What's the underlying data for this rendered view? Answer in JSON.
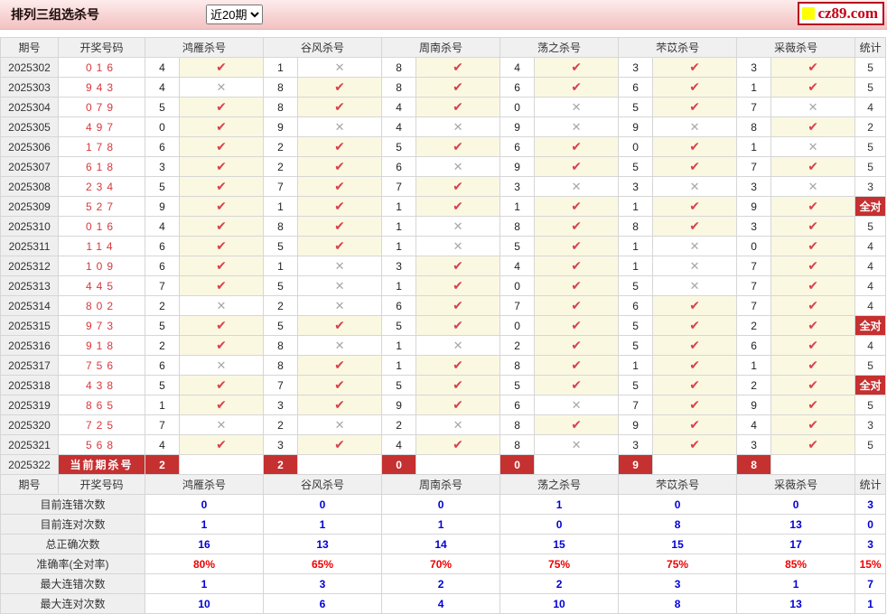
{
  "title_bar": {
    "title": "排列三组选杀号",
    "range_select": {
      "selected": "近20期"
    },
    "logo_text": "cz89.com"
  },
  "marks": {
    "check": "✔",
    "cross": "✕"
  },
  "colors": {
    "accent_red": "#c53030",
    "check_red": "#d8414d",
    "cross_gray": "#a7a7a7",
    "ok_cell_bg": "#fbf8e2",
    "value_blue": "#0000d6",
    "value_red": "#ee0000",
    "titlebar_pink": "#f6cdcd",
    "logo_yellow": "#ffff00"
  },
  "table": {
    "headers": {
      "period": "期号",
      "numbers": "开奖号码",
      "experts": [
        "鸿雁杀号",
        "谷风杀号",
        "周南杀号",
        "荡之杀号",
        "芣苡杀号",
        "采薇杀号"
      ],
      "stat": "统计"
    },
    "all_correct_label": "全对",
    "rows": [
      {
        "period": "2025302",
        "numbers": "016",
        "kills": [
          {
            "n": "4",
            "ok": true
          },
          {
            "n": "1",
            "ok": false
          },
          {
            "n": "8",
            "ok": true
          },
          {
            "n": "4",
            "ok": true
          },
          {
            "n": "3",
            "ok": true
          },
          {
            "n": "3",
            "ok": true
          }
        ],
        "stat": "5",
        "all_correct": false
      },
      {
        "period": "2025303",
        "numbers": "943",
        "kills": [
          {
            "n": "4",
            "ok": false
          },
          {
            "n": "8",
            "ok": true
          },
          {
            "n": "8",
            "ok": true
          },
          {
            "n": "6",
            "ok": true
          },
          {
            "n": "6",
            "ok": true
          },
          {
            "n": "1",
            "ok": true
          }
        ],
        "stat": "5",
        "all_correct": false
      },
      {
        "period": "2025304",
        "numbers": "079",
        "kills": [
          {
            "n": "5",
            "ok": true
          },
          {
            "n": "8",
            "ok": true
          },
          {
            "n": "4",
            "ok": true
          },
          {
            "n": "0",
            "ok": false
          },
          {
            "n": "5",
            "ok": true
          },
          {
            "n": "7",
            "ok": false
          }
        ],
        "stat": "4",
        "all_correct": false
      },
      {
        "period": "2025305",
        "numbers": "497",
        "kills": [
          {
            "n": "0",
            "ok": true
          },
          {
            "n": "9",
            "ok": false
          },
          {
            "n": "4",
            "ok": false
          },
          {
            "n": "9",
            "ok": false
          },
          {
            "n": "9",
            "ok": false
          },
          {
            "n": "8",
            "ok": true
          }
        ],
        "stat": "2",
        "all_correct": false
      },
      {
        "period": "2025306",
        "numbers": "178",
        "kills": [
          {
            "n": "6",
            "ok": true
          },
          {
            "n": "2",
            "ok": true
          },
          {
            "n": "5",
            "ok": true
          },
          {
            "n": "6",
            "ok": true
          },
          {
            "n": "0",
            "ok": true
          },
          {
            "n": "1",
            "ok": false
          }
        ],
        "stat": "5",
        "all_correct": false
      },
      {
        "period": "2025307",
        "numbers": "618",
        "kills": [
          {
            "n": "3",
            "ok": true
          },
          {
            "n": "2",
            "ok": true
          },
          {
            "n": "6",
            "ok": false
          },
          {
            "n": "9",
            "ok": true
          },
          {
            "n": "5",
            "ok": true
          },
          {
            "n": "7",
            "ok": true
          }
        ],
        "stat": "5",
        "all_correct": false
      },
      {
        "period": "2025308",
        "numbers": "234",
        "kills": [
          {
            "n": "5",
            "ok": true
          },
          {
            "n": "7",
            "ok": true
          },
          {
            "n": "7",
            "ok": true
          },
          {
            "n": "3",
            "ok": false
          },
          {
            "n": "3",
            "ok": false
          },
          {
            "n": "3",
            "ok": false
          }
        ],
        "stat": "3",
        "all_correct": false
      },
      {
        "period": "2025309",
        "numbers": "527",
        "kills": [
          {
            "n": "9",
            "ok": true
          },
          {
            "n": "1",
            "ok": true
          },
          {
            "n": "1",
            "ok": true
          },
          {
            "n": "1",
            "ok": true
          },
          {
            "n": "1",
            "ok": true
          },
          {
            "n": "9",
            "ok": true
          }
        ],
        "stat": "全对",
        "all_correct": true
      },
      {
        "period": "2025310",
        "numbers": "016",
        "kills": [
          {
            "n": "4",
            "ok": true
          },
          {
            "n": "8",
            "ok": true
          },
          {
            "n": "1",
            "ok": false
          },
          {
            "n": "8",
            "ok": true
          },
          {
            "n": "8",
            "ok": true
          },
          {
            "n": "3",
            "ok": true
          }
        ],
        "stat": "5",
        "all_correct": false
      },
      {
        "period": "2025311",
        "numbers": "114",
        "kills": [
          {
            "n": "6",
            "ok": true
          },
          {
            "n": "5",
            "ok": true
          },
          {
            "n": "1",
            "ok": false
          },
          {
            "n": "5",
            "ok": true
          },
          {
            "n": "1",
            "ok": false
          },
          {
            "n": "0",
            "ok": true
          }
        ],
        "stat": "4",
        "all_correct": false
      },
      {
        "period": "2025312",
        "numbers": "109",
        "kills": [
          {
            "n": "6",
            "ok": true
          },
          {
            "n": "1",
            "ok": false
          },
          {
            "n": "3",
            "ok": true
          },
          {
            "n": "4",
            "ok": true
          },
          {
            "n": "1",
            "ok": false
          },
          {
            "n": "7",
            "ok": true
          }
        ],
        "stat": "4",
        "all_correct": false
      },
      {
        "period": "2025313",
        "numbers": "445",
        "kills": [
          {
            "n": "7",
            "ok": true
          },
          {
            "n": "5",
            "ok": false
          },
          {
            "n": "1",
            "ok": true
          },
          {
            "n": "0",
            "ok": true
          },
          {
            "n": "5",
            "ok": false
          },
          {
            "n": "7",
            "ok": true
          }
        ],
        "stat": "4",
        "all_correct": false
      },
      {
        "period": "2025314",
        "numbers": "802",
        "kills": [
          {
            "n": "2",
            "ok": false
          },
          {
            "n": "2",
            "ok": false
          },
          {
            "n": "6",
            "ok": true
          },
          {
            "n": "7",
            "ok": true
          },
          {
            "n": "6",
            "ok": true
          },
          {
            "n": "7",
            "ok": true
          }
        ],
        "stat": "4",
        "all_correct": false
      },
      {
        "period": "2025315",
        "numbers": "973",
        "kills": [
          {
            "n": "5",
            "ok": true
          },
          {
            "n": "5",
            "ok": true
          },
          {
            "n": "5",
            "ok": true
          },
          {
            "n": "0",
            "ok": true
          },
          {
            "n": "5",
            "ok": true
          },
          {
            "n": "2",
            "ok": true
          }
        ],
        "stat": "全对",
        "all_correct": true
      },
      {
        "period": "2025316",
        "numbers": "918",
        "kills": [
          {
            "n": "2",
            "ok": true
          },
          {
            "n": "8",
            "ok": false
          },
          {
            "n": "1",
            "ok": false
          },
          {
            "n": "2",
            "ok": true
          },
          {
            "n": "5",
            "ok": true
          },
          {
            "n": "6",
            "ok": true
          }
        ],
        "stat": "4",
        "all_correct": false
      },
      {
        "period": "2025317",
        "numbers": "756",
        "kills": [
          {
            "n": "6",
            "ok": false
          },
          {
            "n": "8",
            "ok": true
          },
          {
            "n": "1",
            "ok": true
          },
          {
            "n": "8",
            "ok": true
          },
          {
            "n": "1",
            "ok": true
          },
          {
            "n": "1",
            "ok": true
          }
        ],
        "stat": "5",
        "all_correct": false
      },
      {
        "period": "2025318",
        "numbers": "438",
        "kills": [
          {
            "n": "5",
            "ok": true
          },
          {
            "n": "7",
            "ok": true
          },
          {
            "n": "5",
            "ok": true
          },
          {
            "n": "5",
            "ok": true
          },
          {
            "n": "5",
            "ok": true
          },
          {
            "n": "2",
            "ok": true
          }
        ],
        "stat": "全对",
        "all_correct": true
      },
      {
        "period": "2025319",
        "numbers": "865",
        "kills": [
          {
            "n": "1",
            "ok": true
          },
          {
            "n": "3",
            "ok": true
          },
          {
            "n": "9",
            "ok": true
          },
          {
            "n": "6",
            "ok": false
          },
          {
            "n": "7",
            "ok": true
          },
          {
            "n": "9",
            "ok": true
          }
        ],
        "stat": "5",
        "all_correct": false
      },
      {
        "period": "2025320",
        "numbers": "725",
        "kills": [
          {
            "n": "7",
            "ok": false
          },
          {
            "n": "2",
            "ok": false
          },
          {
            "n": "2",
            "ok": false
          },
          {
            "n": "8",
            "ok": true
          },
          {
            "n": "9",
            "ok": true
          },
          {
            "n": "4",
            "ok": true
          }
        ],
        "stat": "3",
        "all_correct": false
      },
      {
        "period": "2025321",
        "numbers": "568",
        "kills": [
          {
            "n": "4",
            "ok": true
          },
          {
            "n": "3",
            "ok": true
          },
          {
            "n": "4",
            "ok": true
          },
          {
            "n": "8",
            "ok": false
          },
          {
            "n": "3",
            "ok": true
          },
          {
            "n": "3",
            "ok": true
          }
        ],
        "stat": "5",
        "all_correct": false
      }
    ],
    "current_row": {
      "period": "2025322",
      "label": "当前期杀号",
      "kills": [
        "2",
        "2",
        "0",
        "0",
        "9",
        "8"
      ],
      "stat": ""
    },
    "summary_rows": [
      {
        "label": "目前连错次数",
        "values": [
          "0",
          "0",
          "0",
          "1",
          "0",
          "0"
        ],
        "stat": "3",
        "red": false
      },
      {
        "label": "目前连对次数",
        "values": [
          "1",
          "1",
          "1",
          "0",
          "8",
          "13"
        ],
        "stat": "0",
        "red": false
      },
      {
        "label": "总正确次数",
        "values": [
          "16",
          "13",
          "14",
          "15",
          "15",
          "17"
        ],
        "stat": "3",
        "red": false
      },
      {
        "label": "准确率(全对率)",
        "values": [
          "80%",
          "65%",
          "70%",
          "75%",
          "75%",
          "85%"
        ],
        "stat": "15%",
        "red": true
      },
      {
        "label": "最大连错次数",
        "values": [
          "1",
          "3",
          "2",
          "2",
          "3",
          "1"
        ],
        "stat": "7",
        "red": false
      },
      {
        "label": "最大连对次数",
        "values": [
          "10",
          "6",
          "4",
          "10",
          "8",
          "13"
        ],
        "stat": "1",
        "red": false
      }
    ]
  }
}
